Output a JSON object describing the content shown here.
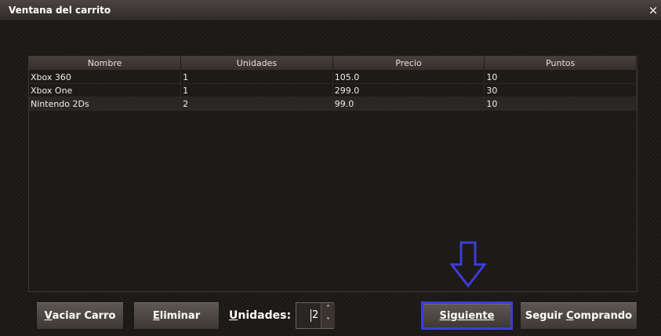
{
  "window": {
    "title": "Ventana del carrito",
    "close_glyph": "×"
  },
  "table": {
    "columns": [
      "Nombre",
      "Unidades",
      "Precio",
      "Puntos"
    ],
    "rows": [
      [
        "Xbox 360",
        "1",
        "105.0",
        "10"
      ],
      [
        "Xbox One",
        "1",
        "299.0",
        "30"
      ],
      [
        "Nintendo 2Ds",
        "2",
        "99.0",
        "10"
      ]
    ],
    "selected_row": 2
  },
  "footer": {
    "vaciar_first": "V",
    "vaciar_rest": "aciar Carro",
    "eliminar_first": "E",
    "eliminar_rest": "liminar",
    "units_first": "U",
    "units_rest": "nidades:",
    "units_value": "2",
    "siguiente_first": "S",
    "siguiente_rest": "iguiente",
    "seguir_start": "Seguir ",
    "seguir_mnemonic": "C",
    "seguir_rest": "omprando"
  },
  "colors": {
    "highlight_border": "#3b3ed8",
    "arrow": "#3b3ed8"
  },
  "icons": {
    "arrow": "down-arrow-icon",
    "close": "close-icon",
    "spin_up": "chevron-up-icon",
    "spin_down": "chevron-down-icon"
  }
}
